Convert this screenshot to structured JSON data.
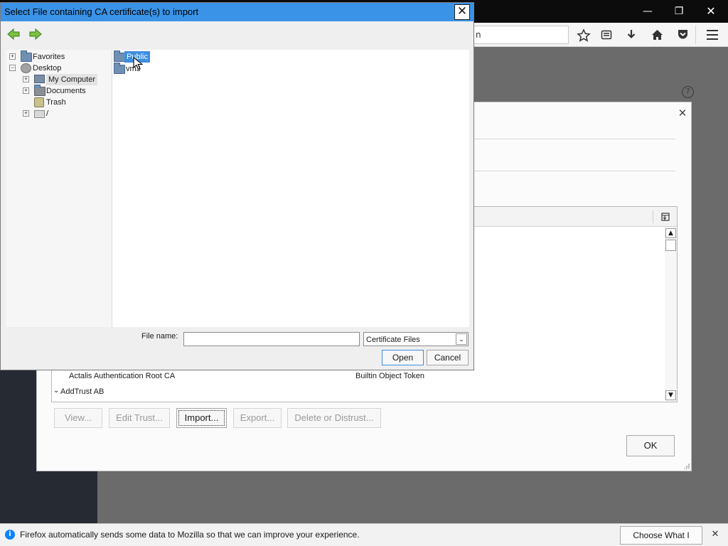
{
  "firefox": {
    "window_controls": {
      "minimize": "—",
      "restore": "❐",
      "close": "✕"
    },
    "toolbar_icons": [
      "star-icon",
      "reading-list-icon",
      "download-icon",
      "home-icon",
      "pocket-icon",
      "menu-icon"
    ],
    "urlbar_fragment": "n"
  },
  "cert_manager": {
    "close_glyph": "✕",
    "help_glyph": "?",
    "columns_picker_icon": "column-picker-icon",
    "rows": [
      {
        "name": "Actalis Authentication Root CA",
        "device": "Builtin Object Token"
      },
      {
        "group": "AddTrust AB"
      }
    ],
    "buttons": {
      "view": "View...",
      "edit_trust": "Edit Trust...",
      "import": "Import...",
      "export": "Export...",
      "delete": "Delete or Distrust...",
      "ok": "OK"
    }
  },
  "file_dialog": {
    "title": "Select File containing CA certificate(s) to import",
    "close_glyph": "✕",
    "nav": {
      "back": "back-arrow-icon",
      "forward": "forward-arrow-icon"
    },
    "tree": [
      {
        "label": "Favorites",
        "icon": "favorites-folder-icon"
      },
      {
        "label": "Desktop",
        "icon": "desktop-icon"
      },
      {
        "label": "My Computer",
        "icon": "computer-icon"
      },
      {
        "label": "Documents",
        "icon": "documents-folder-icon"
      },
      {
        "label": "Trash",
        "icon": "trash-icon"
      },
      {
        "label": "/",
        "icon": "drive-icon"
      }
    ],
    "files": [
      {
        "name": "Public",
        "selected": true
      },
      {
        "name": "vm3",
        "selected": false
      }
    ],
    "file_name_label": "File name:",
    "file_name_value": "",
    "filter_value": "Certificate Files",
    "open_label": "Open",
    "cancel_label": "Cancel"
  },
  "notification": {
    "text": "Firefox automatically sends some data to Mozilla so that we can improve your experience.",
    "button": "Choose What I Share",
    "info_glyph": "i",
    "close_glyph": "✕"
  },
  "colors": {
    "title_blue": "#3a93e6",
    "selection_blue": "#3d8fe0",
    "info_blue": "#0a84ff"
  }
}
